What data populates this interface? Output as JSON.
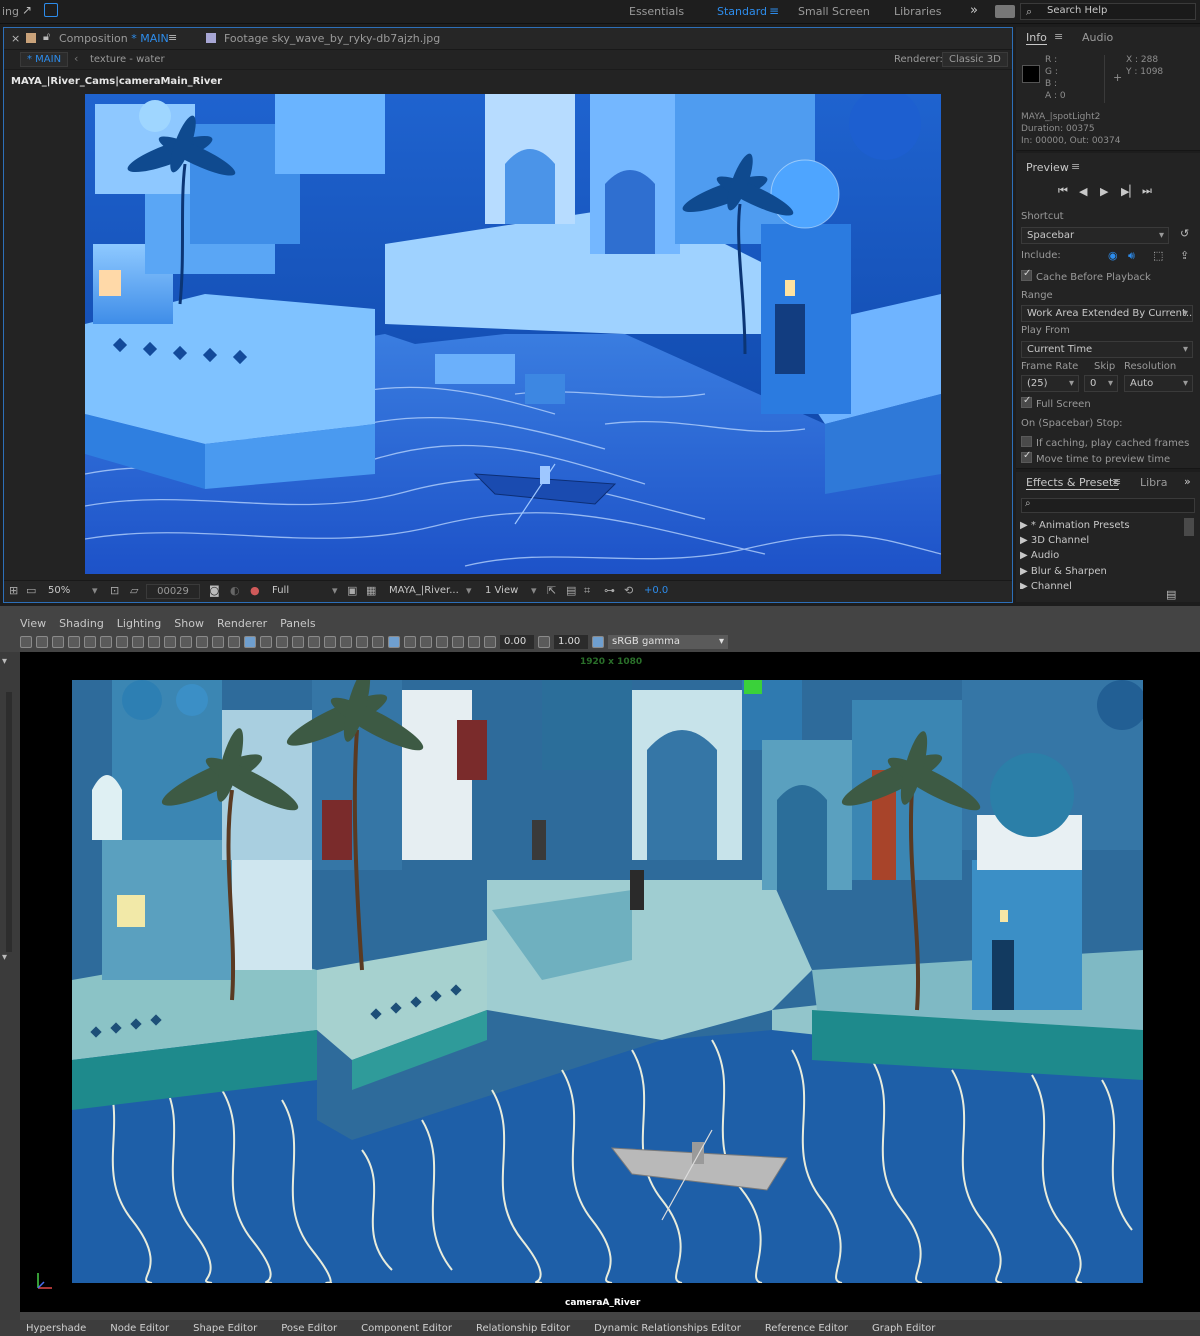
{
  "topbar": {
    "app_fragment": "ing",
    "workspaces": [
      "Essentials",
      "Standard",
      "Small Screen",
      "Libraries"
    ],
    "active_workspace": "Standard",
    "search_placeholder": "Search Help"
  },
  "comp": {
    "tab_comp_prefix": "Composition",
    "tab_comp_name": "* MAIN",
    "tab_footage_prefix": "Footage",
    "tab_footage_name": "sky_wave_by_ryky-db7ajzh.jpg",
    "breadcrumb_main": "* MAIN",
    "breadcrumb_child": "texture - water",
    "renderer_label": "Renderer:",
    "renderer_value": "Classic 3D",
    "layer_label": "MAYA_|River_Cams|cameraMain_River",
    "footer": {
      "zoom": "50%",
      "timecode": "00029",
      "resolution": "Full",
      "camera": "MAYA_|River...",
      "views": "1 View",
      "exposure": "+0.0"
    }
  },
  "info": {
    "tab_info": "Info",
    "tab_audio": "Audio",
    "r": "R :",
    "g": "G :",
    "b": "B :",
    "a": "A :  0",
    "x": "X : 288",
    "y": "Y : 1098",
    "layer_name": "MAYA_|spotLight2",
    "duration": "Duration: 00375",
    "in_out": "In: 00000, Out: 00374"
  },
  "preview": {
    "title": "Preview",
    "shortcut_label": "Shortcut",
    "shortcut_value": "Spacebar",
    "include_label": "Include:",
    "cache_label": "Cache Before Playback",
    "range_label": "Range",
    "range_value": "Work Area Extended By Current...",
    "play_from_label": "Play From",
    "play_from_value": "Current Time",
    "frame_rate_label": "Frame Rate",
    "skip_label": "Skip",
    "resolution_label": "Resolution",
    "frame_rate_value": "(25)",
    "skip_value": "0",
    "resolution_value": "Auto",
    "full_screen_label": "Full Screen",
    "stop_label": "On (Spacebar) Stop:",
    "if_caching_label": "If caching, play cached frames",
    "move_time_label": "Move time to preview time"
  },
  "effects": {
    "tab_effects": "Effects & Presets",
    "tab_libra": "Libra",
    "items": [
      "▶ * Animation Presets",
      "▶ 3D Channel",
      "▶ Audio",
      "▶ Blur & Sharpen",
      "▶ Channel"
    ]
  },
  "maya": {
    "menu": [
      "View",
      "Shading",
      "Lighting",
      "Show",
      "Renderer",
      "Panels"
    ],
    "field_exposure": "0.00",
    "field_gamma": "1.00",
    "color_space": "sRGB gamma",
    "resolution_gate": "1920 x 1080",
    "camera_name": "cameraA_River",
    "bottom_tabs": [
      "Hypershade",
      "Node Editor",
      "Shape Editor",
      "Pose Editor",
      "Component Editor",
      "Relationship Editor",
      "Dynamic Relationships Editor",
      "Reference Editor",
      "Graph Editor"
    ]
  },
  "colors": {
    "accent_blue": "#2d8ceb",
    "panel": "#232323",
    "maya_grey": "#444444",
    "water_blue": "#1e5fa8"
  }
}
